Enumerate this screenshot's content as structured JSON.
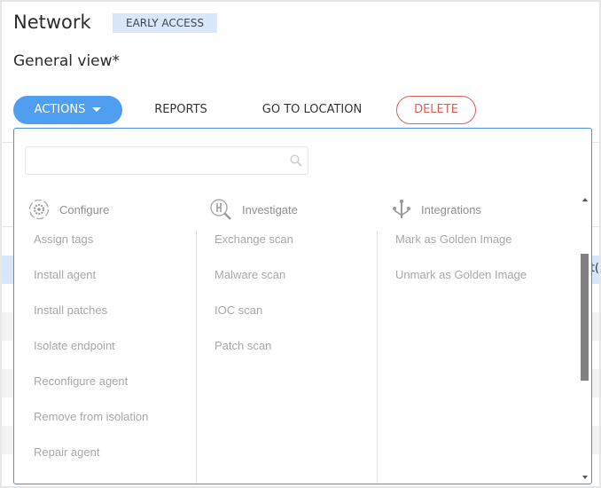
{
  "header": {
    "title": "Network",
    "badge": "EARLY ACCESS",
    "view": "General view*"
  },
  "toolbar": {
    "actions": "ACTIONS",
    "reports": "REPORTS",
    "go_to_location": "GO TO LOCATION",
    "delete": "DELETE"
  },
  "background_table": {
    "partial_text": "t("
  },
  "dropdown": {
    "search": {
      "value": "",
      "placeholder": ""
    },
    "columns": [
      {
        "header": "Configure",
        "icon": "gear-icon",
        "items": [
          "Assign tags",
          "Install agent",
          "Install patches",
          "Isolate endpoint",
          "Reconfigure agent",
          "Remove from isolation",
          "Repair agent"
        ]
      },
      {
        "header": "Investigate",
        "icon": "investigate-magnifier-icon",
        "items": [
          "Exchange scan",
          "Malware scan",
          "IOC scan",
          "Patch scan"
        ]
      },
      {
        "header": "Integrations",
        "icon": "integrations-fork-icon",
        "items": [
          "Mark as Golden Image",
          "Unmark as Golden Image"
        ]
      }
    ]
  },
  "colors": {
    "accent": "#4f9ef0",
    "danger": "#e35b5b",
    "badge_bg": "#d9e7fb",
    "selected_row": "#d6e6fb"
  }
}
